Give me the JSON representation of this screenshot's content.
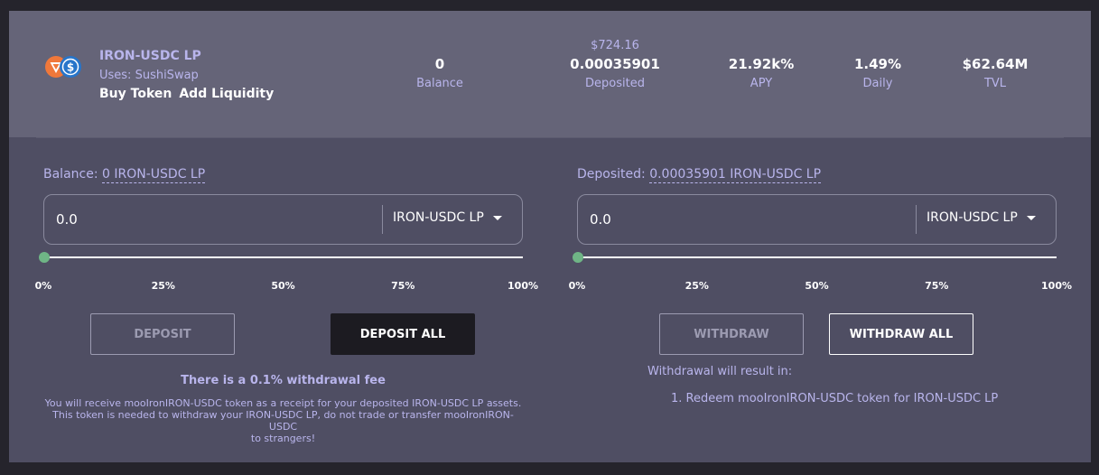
{
  "pool": {
    "name": "IRON-USDC LP",
    "uses": "Uses: SushiSwap",
    "buy_token": "Buy Token",
    "add_liquidity": "Add Liquidity"
  },
  "stats": {
    "balance": {
      "value": "0",
      "label": "Balance"
    },
    "deposited": {
      "usd": "$724.16",
      "value": "0.00035901",
      "label": "Deposited"
    },
    "apy": {
      "value": "21.92k%",
      "label": "APY"
    },
    "daily": {
      "value": "1.49%",
      "label": "Daily"
    },
    "tvl": {
      "value": "$62.64M",
      "label": "TVL"
    }
  },
  "deposit_panel": {
    "balance_prefix": "Balance:",
    "balance_amount": "0 IRON-USDC LP",
    "input_value": "0.0",
    "token": "IRON-USDC LP",
    "slider_percent": 0,
    "ticks": [
      "0%",
      "25%",
      "50%",
      "75%",
      "100%"
    ],
    "deposit_button": "DEPOSIT",
    "deposit_all_button": "DEPOSIT ALL",
    "fee_title": "There is a 0.1% withdrawal fee",
    "note_lines": [
      "You will receive mooIronIRON-USDC token as a receipt for your deposited IRON-USDC LP assets.",
      "This token is needed to withdraw your IRON-USDC LP, do not trade or transfer mooIronIRON-USDC",
      "to strangers!"
    ]
  },
  "withdraw_panel": {
    "deposited_prefix": "Deposited:",
    "deposited_amount": "0.00035901 IRON-USDC LP",
    "input_value": "0.0",
    "token": "IRON-USDC LP",
    "slider_percent": 0,
    "ticks": [
      "0%",
      "25%",
      "50%",
      "75%",
      "100%"
    ],
    "withdraw_button": "WITHDRAW",
    "withdraw_all_button": "WITHDRAW ALL",
    "result_title": "Withdrawal will result in:",
    "result_item": "1. Redeem mooIronIRON-USDC token for IRON-USDC LP"
  },
  "colors": {
    "accent_text": "#b9b5ec",
    "slider_thumb": "#6fb586",
    "header_bg": "#656478",
    "card_bg": "#4f4e63"
  },
  "icons": {
    "iron_token": "iron-token-icon",
    "usdc_token": "usdc-token-icon",
    "dropdown": "caret-down-icon"
  }
}
